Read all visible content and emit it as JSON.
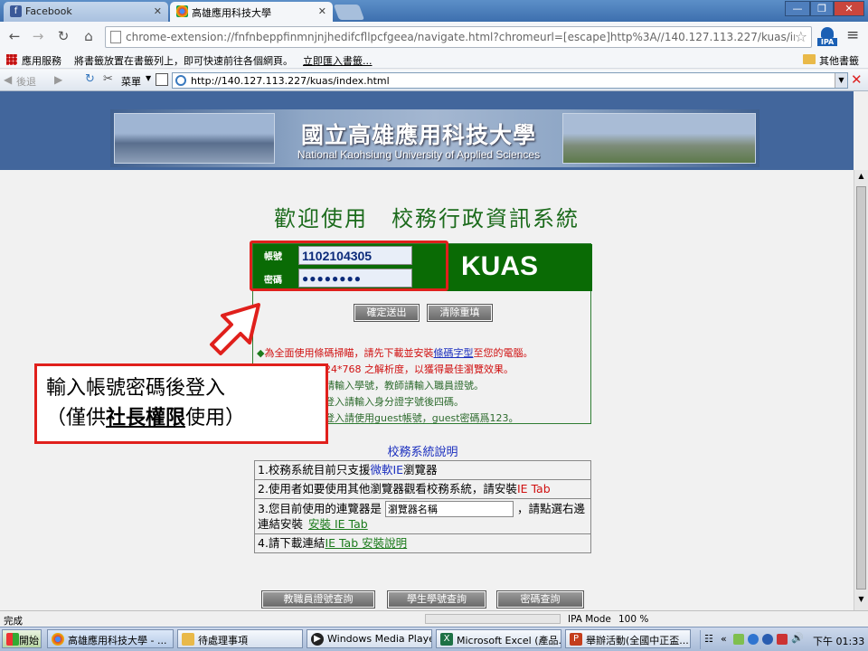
{
  "browser": {
    "tabs": [
      {
        "label": "Facebook",
        "icon": "facebook-icon"
      },
      {
        "label": "高雄應用科技大學",
        "icon": "chrome-icon"
      }
    ],
    "url": "chrome-extension://fnfnbeppfinmnjnjhedifcfllpcfgeea/navigate.html?chromeurl=[escape]http%3A//140.127.113.227/kuas/ind",
    "bookmarks_apps": "應用服務",
    "bookmarks_hint": "將書籤放置在書籤列上，即可快速前往各個網頁。",
    "bookmarks_import": "立即匯入書籤...",
    "bookmarks_other": "其他書籤",
    "ipa_label": "IPA"
  },
  "ietab": {
    "back": "後退",
    "menu": "菜單",
    "url": "http://140.127.113.227/kuas/index.html"
  },
  "banner": {
    "title_zh": "國立高雄應用科技大學",
    "title_en": "National Kaohsiung University of Applied Sciences"
  },
  "page": {
    "welcome": "歡迎使用　校務行政資訊系統",
    "login": {
      "account_label": "帳號",
      "account_value": "1102104305",
      "password_label": "密碼",
      "password_value": "●●●●●●●●",
      "logo": "KUAS",
      "submit": "確定送出",
      "reset": "清除重填"
    },
    "notes": {
      "n1_prefix": "為全面使用條碼掃瞄，請先下載並安裝",
      "n1_link": "條碼字型",
      "n1_suffix": "至您的電腦。",
      "n2": "24*768 之解析度，以獲得最佳瀏覽效果。",
      "n3": "請輸入學號，教師請輸入職員證號。",
      "n4": "登入請輸入身分證字號後四碼。",
      "n5": "登入請使用guest帳號，guest密碼爲123。"
    },
    "help": {
      "title": "校務系統說明",
      "r1_prefix": "1.校務系統目前只支援",
      "r1_link": "微軟IE",
      "r1_suffix": "瀏覽器",
      "r2_prefix": "2.使用者如要使用其他瀏覽器觀看校務系統，請安裝",
      "r2_link": "IE Tab",
      "r3_prefix": "3.您目前使用的連覽器是",
      "r3_input": "瀏覽器名稱",
      "r3_suffix": "，請點選右邊連結安裝",
      "r3_link": "安裝 IE Tab",
      "r4_prefix": "4.請下載連結",
      "r4_link": "IE Tab 安裝說明"
    },
    "bottom_buttons": [
      "教職員證號查詢",
      "學生學號查詢",
      "密碼查詢"
    ]
  },
  "callout": {
    "line1": "輸入帳號密碼後登入",
    "line2_a": "（僅供",
    "line2_b": "社長權限",
    "line2_c": "使用）"
  },
  "status": {
    "left": "完成",
    "mode": "IPA Mode",
    "zoom": "100 %"
  },
  "taskbar": {
    "start": "開始",
    "tasks": [
      {
        "label": "高雄應用科技大學 - ...",
        "icon": "chrome-icon"
      },
      {
        "label": "待處理事項",
        "icon": "folder-icon"
      },
      {
        "label": "Windows Media Player",
        "icon": "media-player-icon"
      },
      {
        "label": "Microsoft Excel (產品...",
        "icon": "excel-icon"
      },
      {
        "label": "舉辦活動(全國中正盃...",
        "icon": "powerpoint-icon"
      }
    ],
    "clock": "下午 01:33"
  },
  "colors": {
    "accent_green": "#0a6b05",
    "callout_red": "#e0201c",
    "banner_blue": "#42669c"
  }
}
